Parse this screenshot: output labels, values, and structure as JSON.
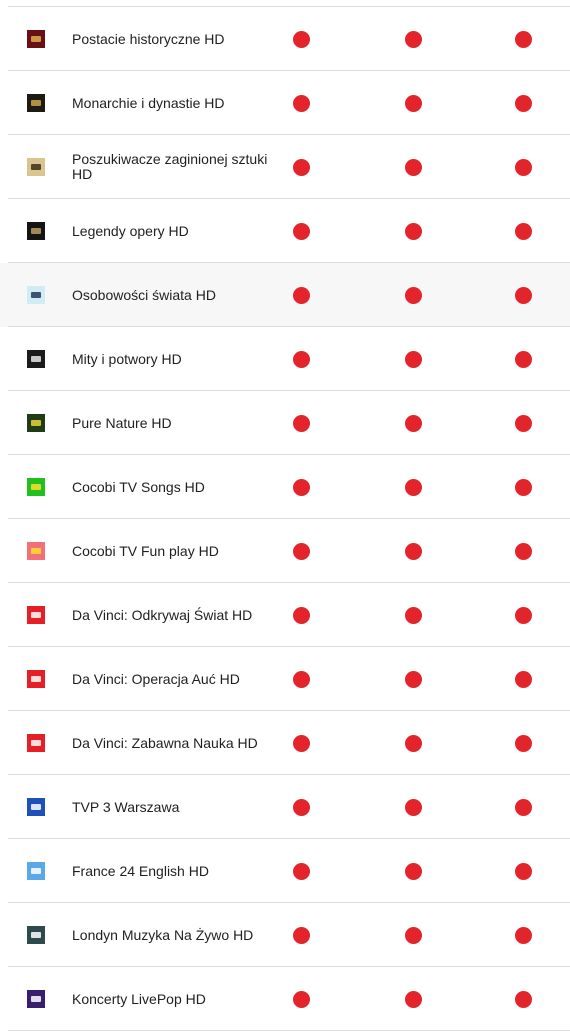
{
  "colors": {
    "availability_dot": "#e3242b",
    "divider": "#dcdcdc",
    "text": "#1f1f1f"
  },
  "channels": [
    {
      "name": "Postacie historyczne HD",
      "logo_icon": "crown-logo-icon",
      "logo_bg": "#6b0f16",
      "logo_fg": "#d8b24a",
      "logo_text": "",
      "available": [
        true,
        true,
        true
      ]
    },
    {
      "name": "Monarchie i dynastie HD",
      "logo_icon": "monarchie-logo-icon",
      "logo_bg": "#1d1a14",
      "logo_fg": "#c9a44a",
      "logo_text": "",
      "available": [
        true,
        true,
        true
      ]
    },
    {
      "name": "Poszukiwacze zaginionej sztuki HD",
      "logo_icon": "lost-art-logo-icon",
      "logo_bg": "#d9c590",
      "logo_fg": "#3b2f1a",
      "logo_text": "",
      "available": [
        true,
        true,
        true
      ]
    },
    {
      "name": "Legendy opery HD",
      "logo_icon": "opera-logo-icon",
      "logo_bg": "#141414",
      "logo_fg": "#b9a062",
      "logo_text": "",
      "available": [
        true,
        true,
        true
      ]
    },
    {
      "name": "Osobowości świata HD",
      "logo_icon": "world-personalities-logo-icon",
      "logo_bg": "#d3ecf4",
      "logo_fg": "#1f3a5a",
      "logo_text": "",
      "available": [
        true,
        true,
        true
      ]
    },
    {
      "name": "Mity i potwory HD",
      "logo_icon": "hooded-figure-logo-icon",
      "logo_bg": "#1b1b1b",
      "logo_fg": "#e8e8e8",
      "logo_text": "",
      "available": [
        true,
        true,
        true
      ]
    },
    {
      "name": "Pure Nature HD",
      "logo_icon": "pure-nature-logo-icon",
      "logo_bg": "#1e3d16",
      "logo_fg": "#e8d33a",
      "logo_text": "",
      "available": [
        true,
        true,
        true
      ]
    },
    {
      "name": "Cocobi TV Songs HD",
      "logo_icon": "cocobi-songs-logo-icon",
      "logo_bg": "#20c020",
      "logo_fg": "#ffde2b",
      "logo_text": "",
      "available": [
        true,
        true,
        true
      ]
    },
    {
      "name": "Cocobi TV Fun play HD",
      "logo_icon": "cocobi-fun-play-logo-icon",
      "logo_bg": "#f1707a",
      "logo_fg": "#ffde2b",
      "logo_text": "",
      "available": [
        true,
        true,
        true
      ]
    },
    {
      "name": "Da Vinci: Odkrywaj Świat HD",
      "logo_icon": "da-vinci-logo-icon",
      "logo_bg": "#e61e25",
      "logo_fg": "#ffffff",
      "logo_text": "",
      "available": [
        true,
        true,
        true
      ]
    },
    {
      "name": "Da Vinci: Operacja Auć HD",
      "logo_icon": "da-vinci-logo-icon",
      "logo_bg": "#e61e25",
      "logo_fg": "#ffffff",
      "logo_text": "",
      "available": [
        true,
        true,
        true
      ]
    },
    {
      "name": "Da Vinci: Zabawna Nauka HD",
      "logo_icon": "da-vinci-logo-icon",
      "logo_bg": "#e61e25",
      "logo_fg": "#ffffff",
      "logo_text": "",
      "available": [
        true,
        true,
        true
      ]
    },
    {
      "name": "TVP 3 Warszawa",
      "logo_icon": "tvp3-logo-icon",
      "logo_bg": "#1f4fb8",
      "logo_fg": "#ffffff",
      "logo_text": "",
      "available": [
        true,
        true,
        true
      ]
    },
    {
      "name": "France 24 English HD",
      "logo_icon": "france24-logo-icon",
      "logo_bg": "#5aa8e8",
      "logo_fg": "#ffffff",
      "logo_text": "",
      "available": [
        true,
        true,
        true
      ]
    },
    {
      "name": "Londyn Muzyka Na Żywo HD",
      "logo_icon": "london-live-music-logo-icon",
      "logo_bg": "#2f4a4a",
      "logo_fg": "#ffffff",
      "logo_text": "",
      "available": [
        true,
        true,
        true
      ]
    },
    {
      "name": "Koncerty LivePop HD",
      "logo_icon": "livepop-logo-icon",
      "logo_bg": "#3a1e6e",
      "logo_fg": "#ffffff",
      "logo_text": "",
      "available": [
        true,
        true,
        true
      ]
    }
  ]
}
